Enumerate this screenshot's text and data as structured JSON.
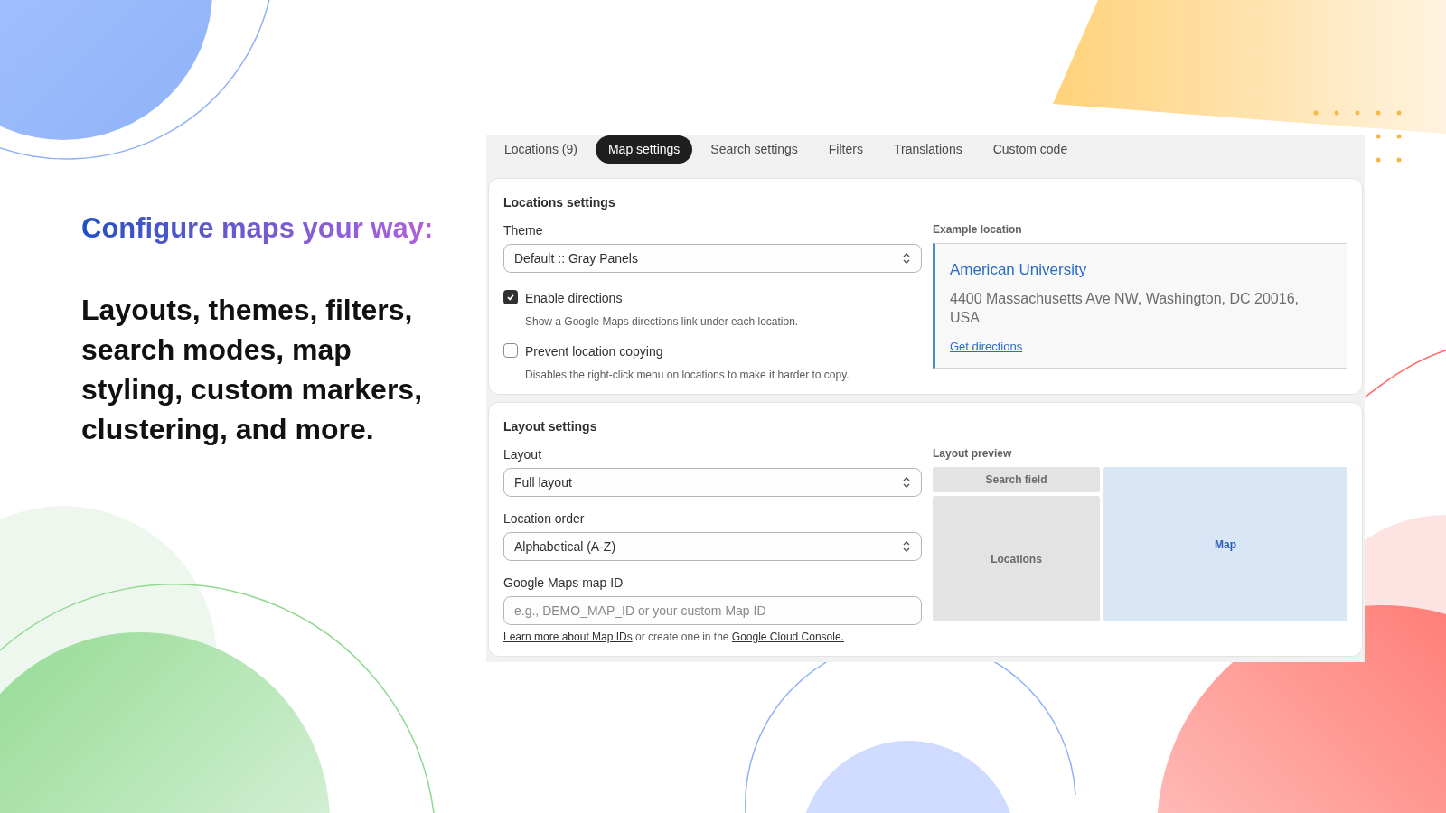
{
  "headline": "Configure maps your way:",
  "features": "Layouts, themes, filters, search modes, map styling, custom markers, clustering, and more.",
  "tabs": [
    {
      "label": "Locations (9)",
      "selected": false
    },
    {
      "label": "Map settings",
      "selected": true
    },
    {
      "label": "Search settings",
      "selected": false
    },
    {
      "label": "Filters",
      "selected": false
    },
    {
      "label": "Translations",
      "selected": false
    },
    {
      "label": "Custom code",
      "selected": false
    }
  ],
  "locations_settings": {
    "title": "Locations settings",
    "theme": {
      "label": "Theme",
      "value": "Default :: Gray Panels"
    },
    "options": [
      {
        "label": "Enable directions",
        "help": "Show a Google Maps directions link under each location.",
        "checked": true
      },
      {
        "label": "Prevent location copying",
        "help": "Disables the right-click menu on locations to make it harder to copy.",
        "checked": false
      }
    ],
    "example": {
      "label": "Example location",
      "name": "American University",
      "address": "4400 Massachusetts Ave NW, Washington, DC 20016, USA",
      "link": "Get directions"
    }
  },
  "layout_settings": {
    "title": "Layout settings",
    "layout": {
      "label": "Layout",
      "value": "Full layout"
    },
    "order": {
      "label": "Location order",
      "value": "Alphabetical (A-Z)"
    },
    "map_id": {
      "label": "Google Maps map ID",
      "placeholder": "e.g., DEMO_MAP_ID or your custom Map ID"
    },
    "help": [
      {
        "kind": "link",
        "text": "Learn more about Map IDs"
      },
      {
        "kind": "text",
        "text": "or create one in the"
      },
      {
        "kind": "link",
        "text": "Google Cloud Console."
      }
    ],
    "preview": {
      "label": "Layout preview",
      "search": "Search field",
      "locations": "Locations",
      "map": "Map"
    }
  }
}
